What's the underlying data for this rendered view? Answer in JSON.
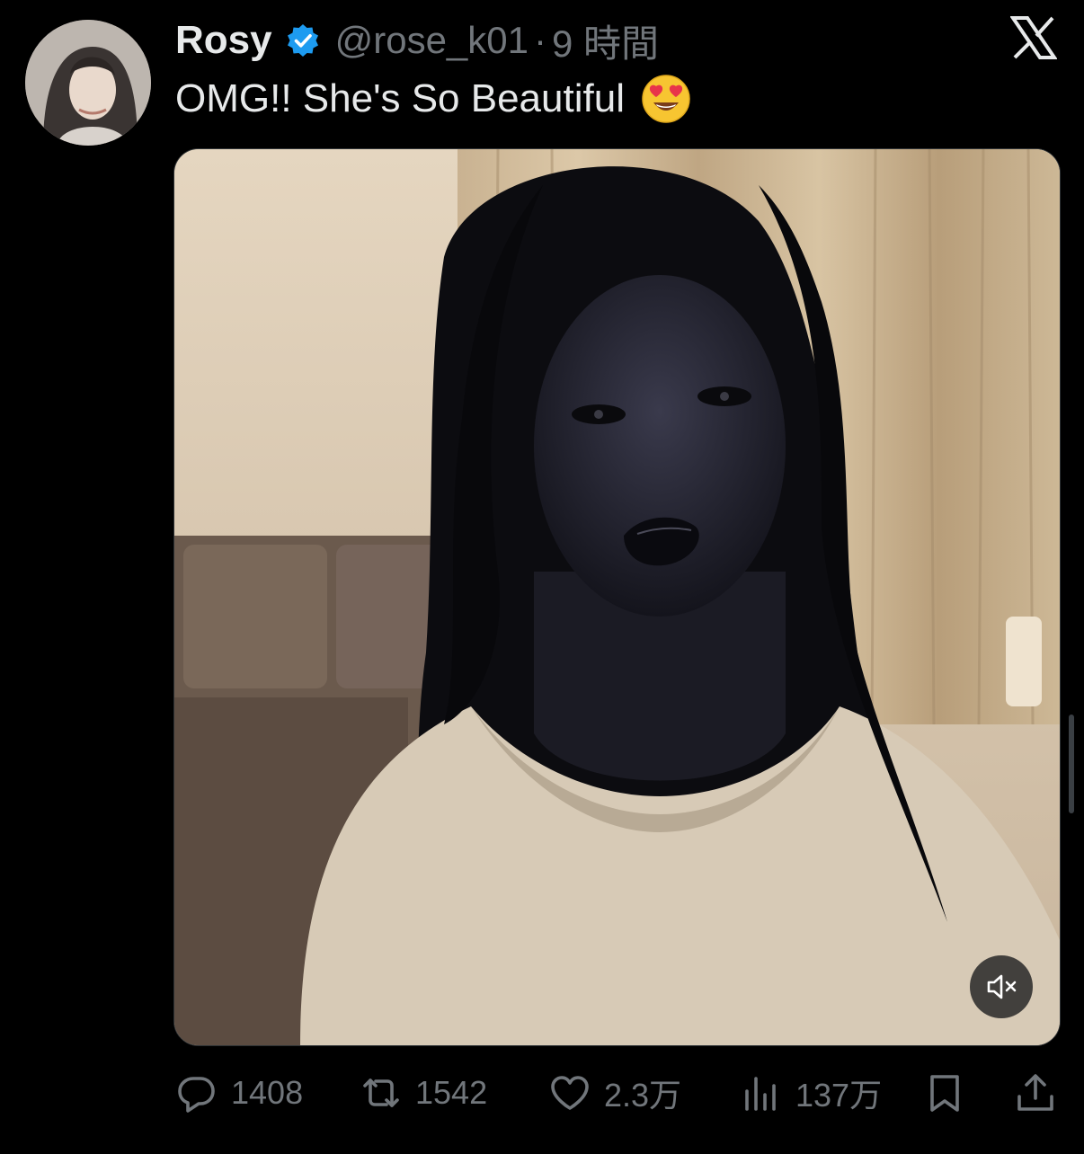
{
  "tweet": {
    "author_name": "Rosy",
    "author_handle": "@rose_k01",
    "separator": "·",
    "time_ago": "9 時間",
    "text": "OMG!! She's So Beautiful",
    "emoji_icon": "heart-eyes-emoji"
  },
  "icons": {
    "verified": "verified-badge-icon",
    "platform": "x-logo-icon",
    "mute": "speaker-muted-icon",
    "reply": "reply-icon",
    "repost": "repost-icon",
    "like": "heart-icon",
    "views": "views-icon",
    "bookmark": "bookmark-icon",
    "share": "share-icon"
  },
  "stats": {
    "replies": "1408",
    "reposts": "1542",
    "likes": "2.3万",
    "views": "137万"
  },
  "colors": {
    "background": "#000000",
    "primary_text": "#e7e9ea",
    "secondary_text": "#71767b",
    "verified_blue": "#1d9bf0"
  }
}
